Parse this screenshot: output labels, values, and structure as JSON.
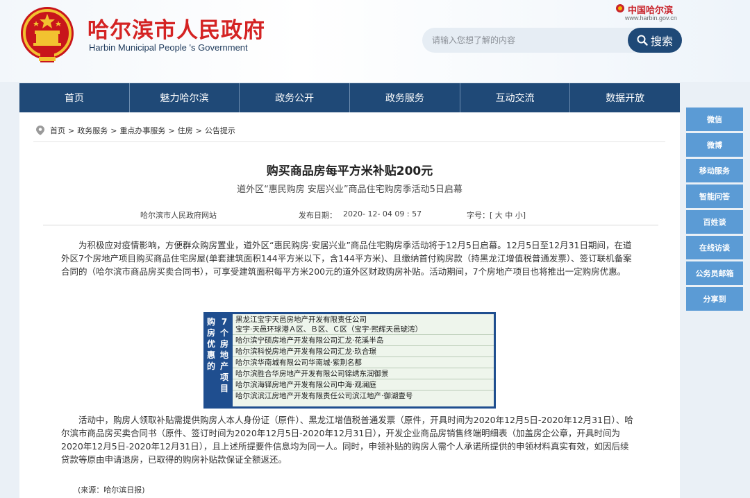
{
  "header": {
    "site_title": "哈尔滨市人民政府",
    "site_subtitle": "Harbin Municipal People 's Government",
    "brand_cn": "中国哈尔滨",
    "brand_url": "www.harbin.gov.cn"
  },
  "search": {
    "placeholder": "请输入您想了解的内容",
    "button_label": "搜索"
  },
  "nav": {
    "items": [
      "首页",
      "魅力哈尔滨",
      "政务公开",
      "政务服务",
      "互动交流",
      "数据开放"
    ]
  },
  "side": {
    "items": [
      "微信",
      "微博",
      "移动服务",
      "智能问答",
      "百姓谈",
      "在线访谈",
      "公务员邮箱",
      "分享到"
    ]
  },
  "breadcrumb": {
    "items": [
      "首页",
      "政务服务",
      "重点办事服务",
      "住房",
      "公告提示"
    ],
    "separator": ">"
  },
  "article": {
    "title": "购买商品房每平方米补贴200元",
    "subtitle": "道外区“惠民购房 安居兴业”商品住宅购房季活动5日启幕",
    "source_site": "哈尔滨市人民政府网站",
    "publish_label": "发布日期：",
    "publish_date": "2020- 12- 04    09 : 57",
    "font_size_label": "字号：[ 大 中 小]",
    "para1": "为积极应对疫情影响，方便群众购房置业，道外区“惠民购房·安居兴业”商品住宅购房季活动将于12月5日启幕。12月5日至12月31日期间，在道外区7个房地产项目购买商品住宅房屋(单套建筑面积144平方米以下，含144平方米)、且缴纳首付购房款（持黑龙江增值税普通发票）、签订联机备案合同的（哈尔滨市商品房买卖合同书），可享受建筑面积每平方米200元的道外区财政购房补贴。活动期间，7个房地产项目也将推出一定购房优惠。",
    "para2": "活动中，购房人领取补贴需提供购房人本人身份证（原件）、黑龙江增值税普通发票（原件，开具时间为2020年12月5日-2020年12月31日）、哈尔滨市商品房买卖合同书（原件、签订时间为2020年12月5日-2020年12月31日），开发企业商品房销售终端明细表（加盖房企公章，开具时间为2020年12月5日-2020年12月31日），且上述所提要件信息均为同一人。同时，申领补贴的购房人需个人承诺所提供的申领材料真实有效，如因后续贷款等原由申请退房，已取得的购房补贴款保证全额返还。",
    "source_note": "(来源：哈尔滨日报)"
  },
  "poster": {
    "label_left": "购房优惠的",
    "label_right": "7个房地产项目",
    "rows": [
      "黑龙江宝宇天邑房地产开发有限责任公司",
      "宝宇·天邑环球港Ａ区、Ｂ区、Ｃ区（宝宇·熙辉天邑琥湾）",
      "哈尔滨宁硕房地产开发有限公司汇龙·花溪半岛",
      "哈尔滨科悦房地产开发有限公司汇龙·玖合璟",
      "哈尔滨华南城有限公司华南城·紫荆名都",
      "哈尔滨胜合华房地产开发有限公司锦绣东润御景",
      "哈尔滨海铎房地产开发有限公司中海·观澜庭",
      "哈尔滨滨江房地产开发有限责任公司滨江地产·御湖壹号"
    ]
  },
  "colors": {
    "nav_bg": "#1f4977",
    "side_bg": "#5b9bd5",
    "title_red": "#d42323",
    "poster_blue": "#1f4e8f"
  }
}
